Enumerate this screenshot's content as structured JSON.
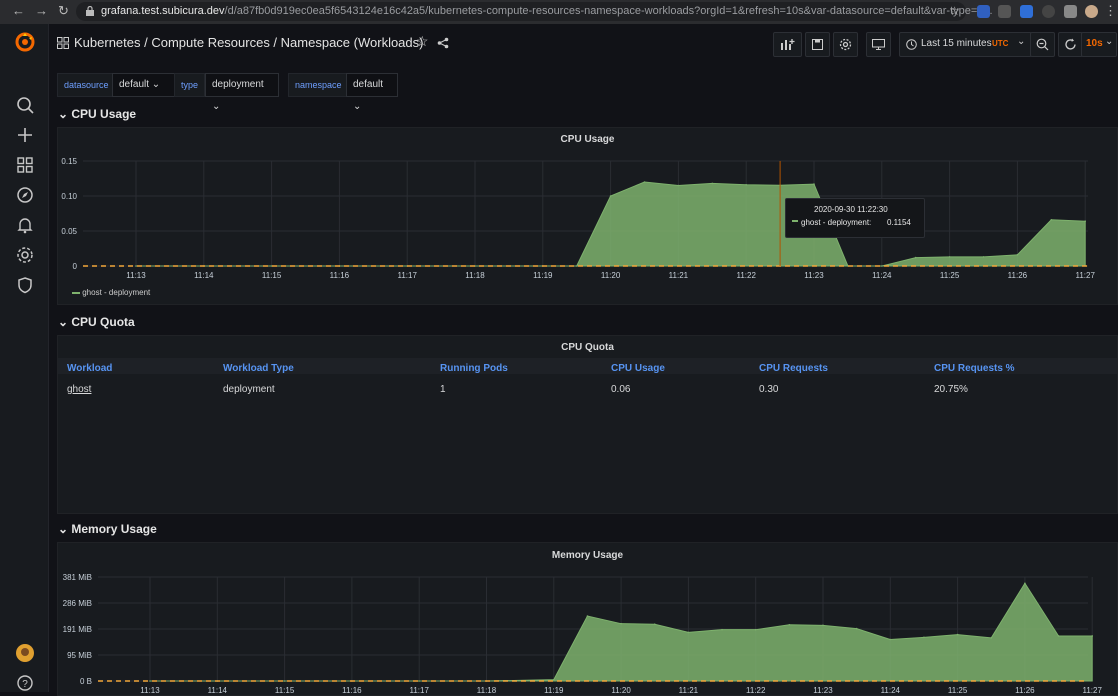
{
  "browser": {
    "url_host": "grafana.test.subicura.dev",
    "url_path": "/d/a87fb0d919ec0ea5f6543124e16c42a5/kubernetes-compute-resources-namespace-workloads?orgId=1&refresh=10s&var-datasource=default&var-type=d..."
  },
  "header": {
    "title": "Kubernetes / Compute Resources / Namespace (Workloads)",
    "time_range": "Last 15 minutes",
    "timezone": "UTC",
    "refresh": "10s"
  },
  "variables": [
    {
      "label": "datasource",
      "value": "default"
    },
    {
      "label": "type",
      "value": "deployment"
    },
    {
      "label": "namespace",
      "value": "default"
    }
  ],
  "rows": {
    "cpu_usage": "CPU Usage",
    "cpu_quota": "CPU Quota",
    "memory_usage": "Memory Usage"
  },
  "cpu_panel": {
    "title": "CPU Usage",
    "legend": "ghost - deployment",
    "tooltip_time": "2020-09-30 11:22:30",
    "tooltip_series": "ghost - deployment:",
    "tooltip_value": "0.1154"
  },
  "quota_panel": {
    "title": "CPU Quota",
    "columns": [
      "Workload",
      "Workload Type",
      "Running Pods",
      "CPU Usage",
      "CPU Requests",
      "CPU Requests %"
    ],
    "rows": [
      [
        "ghost",
        "deployment",
        "1",
        "0.06",
        "0.30",
        "20.75%"
      ]
    ]
  },
  "memory_panel": {
    "title": "Memory Usage"
  },
  "colors": {
    "series_fill": "#7eb26d",
    "threshold_line": "#f2a83a",
    "accent_blue": "#5794f2",
    "grafana_orange": "#f46800"
  },
  "chart_data": [
    {
      "type": "area",
      "title": "CPU Usage",
      "x": [
        "11:13",
        "11:14",
        "11:15",
        "11:16",
        "11:17",
        "11:18",
        "11:19",
        "11:19:30",
        "11:20",
        "11:20:30",
        "11:21",
        "11:21:30",
        "11:22",
        "11:22:30",
        "11:23",
        "11:23:30",
        "11:24",
        "11:24:30",
        "11:25",
        "11:25:30",
        "11:26",
        "11:26:30",
        "11:27"
      ],
      "series": [
        {
          "name": "ghost - deployment",
          "values": [
            0,
            0,
            0,
            0,
            0,
            0,
            0,
            0,
            0.1,
            0.12,
            0.115,
            0.118,
            0.116,
            0.1154,
            0.117,
            0,
            0,
            0.012,
            0.013,
            0.013,
            0.016,
            0.066,
            0.064
          ]
        }
      ],
      "yticks": [
        "0",
        "0.05",
        "0.10",
        "0.15"
      ],
      "ylim": [
        0,
        0.15
      ],
      "grid": true,
      "legend": "bottom-left"
    },
    {
      "type": "area",
      "title": "Memory Usage",
      "x": [
        "11:13",
        "11:14",
        "11:15",
        "11:16",
        "11:17",
        "11:18",
        "11:19",
        "11:19:30",
        "11:20",
        "11:20:30",
        "11:21",
        "11:21:30",
        "11:22",
        "11:22:30",
        "11:23",
        "11:23:30",
        "11:24",
        "11:24:30",
        "11:25",
        "11:25:30",
        "11:26",
        "11:26:30",
        "11:27"
      ],
      "series": [
        {
          "name": "",
          "values": [
            0,
            0,
            0,
            0,
            0,
            0,
            5,
            238,
            210,
            208,
            178,
            188,
            188,
            206,
            204,
            192,
            152,
            160,
            170,
            158,
            358,
            165,
            165
          ]
        }
      ],
      "yticks": [
        "0 B",
        "95 MiB",
        "191 MiB",
        "286 MiB",
        "381 MiB"
      ],
      "ylim": [
        0,
        381
      ],
      "yunit": "MiB",
      "grid": true
    }
  ]
}
